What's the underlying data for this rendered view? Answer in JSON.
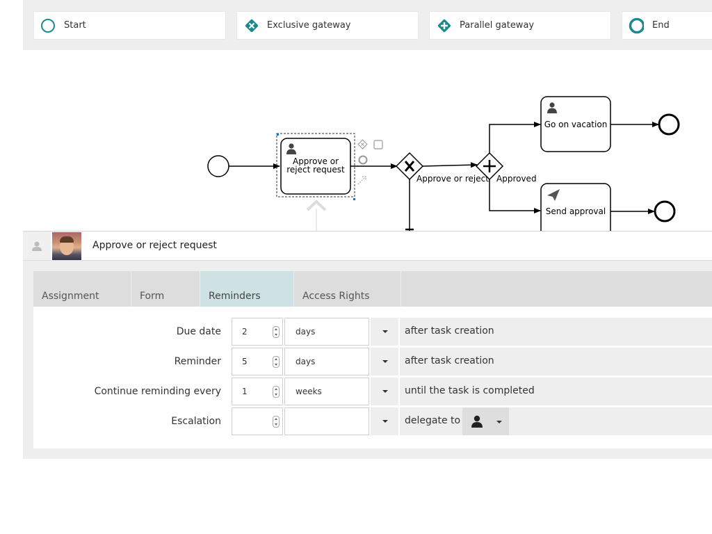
{
  "palette": {
    "items": [
      {
        "label": "Start",
        "icon": "start-event-icon"
      },
      {
        "label": "Exclusive gateway",
        "icon": "exclusive-gateway-icon"
      },
      {
        "label": "Parallel gateway",
        "icon": "parallel-gateway-icon"
      },
      {
        "label": "End",
        "icon": "end-event-icon"
      }
    ]
  },
  "diagram": {
    "task_selected": {
      "label_line1": "Approve or",
      "label_line2": "reject request"
    },
    "task_vacation": {
      "label": "Go on vacation"
    },
    "task_send": {
      "label": "Send approval"
    },
    "flow_labels": {
      "approve_or_reject": "Approve or reject",
      "approved": "Approved"
    }
  },
  "panel": {
    "title": "Approve or reject request",
    "tabs": [
      "Assignment",
      "Form",
      "Reminders",
      "Access Rights"
    ],
    "active_tab": "Reminders",
    "rows": [
      {
        "label": "Due date",
        "value": "2",
        "unit": "days",
        "suffix": "after task creation"
      },
      {
        "label": "Reminder",
        "value": "5",
        "unit": "days",
        "suffix": "after task creation"
      },
      {
        "label": "Continue reminding every",
        "value": "1",
        "unit": "weeks",
        "suffix": "until the task is completed"
      },
      {
        "label": "Escalation",
        "value": "",
        "unit": "",
        "suffix": "delegate to"
      }
    ]
  },
  "colors": {
    "accent": "#1a8a91",
    "active_tab": "#cfe2e3",
    "panel_bg": "#eeeeee"
  }
}
